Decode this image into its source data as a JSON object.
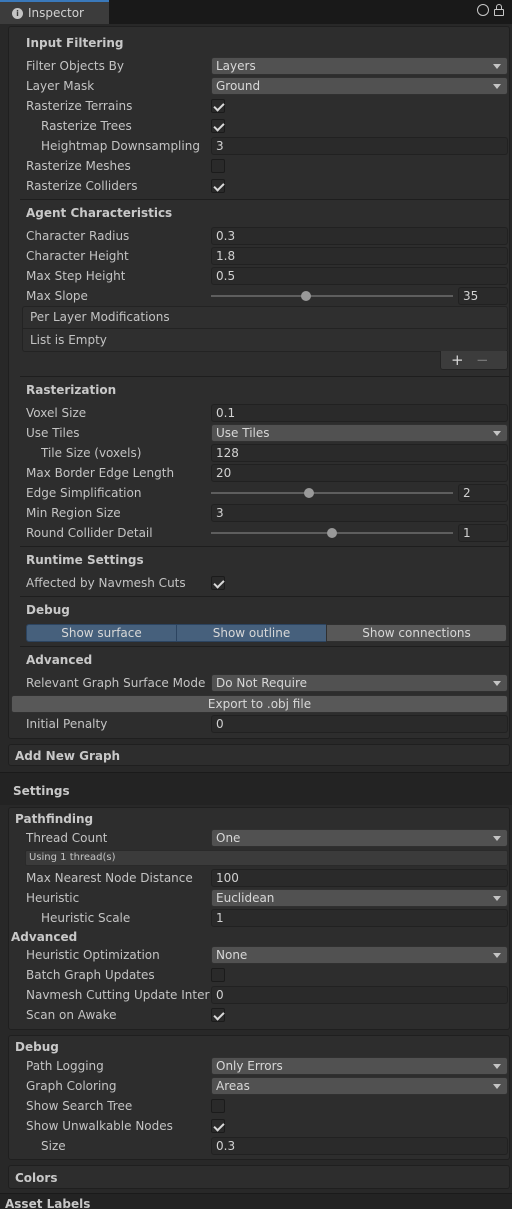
{
  "window": {
    "tab_title": "Inspector",
    "tab_icon": "info-icon"
  },
  "input_filtering": {
    "header": "Input Filtering",
    "filter_objects_by": {
      "label": "Filter Objects By",
      "value": "Layers"
    },
    "layer_mask": {
      "label": "Layer Mask",
      "value": "Ground"
    },
    "rasterize_terrains": {
      "label": "Rasterize Terrains",
      "checked": true
    },
    "rasterize_trees": {
      "label": "Rasterize Trees",
      "checked": true
    },
    "heightmap_downsampling": {
      "label": "Heightmap Downsampling",
      "value": "3"
    },
    "rasterize_meshes": {
      "label": "Rasterize Meshes",
      "checked": false
    },
    "rasterize_colliders": {
      "label": "Rasterize Colliders",
      "checked": true
    }
  },
  "agent": {
    "header": "Agent Characteristics",
    "character_radius": {
      "label": "Character Radius",
      "value": "0.3"
    },
    "character_height": {
      "label": "Character Height",
      "value": "1.8"
    },
    "max_step_height": {
      "label": "Max Step Height",
      "value": "0.5"
    },
    "max_slope": {
      "label": "Max Slope",
      "value": "35",
      "slider_fraction": 0.39
    },
    "per_layer": {
      "title": "Per Layer Modifications",
      "empty_text": "List is Empty",
      "add": "+",
      "remove": "−"
    }
  },
  "rasterization": {
    "header": "Rasterization",
    "voxel_size": {
      "label": "Voxel Size",
      "value": "0.1"
    },
    "use_tiles": {
      "label": "Use Tiles",
      "value": "Use Tiles"
    },
    "tile_size": {
      "label": "Tile Size (voxels)",
      "value": "128"
    },
    "max_border_edge": {
      "label": "Max Border Edge Length",
      "value": "20"
    },
    "edge_simplification": {
      "label": "Edge Simplification",
      "value": "2",
      "slider_fraction": 0.4
    },
    "min_region_size": {
      "label": "Min Region Size",
      "value": "3"
    },
    "round_collider_detail": {
      "label": "Round Collider Detail",
      "value": "1",
      "slider_fraction": 0.5
    }
  },
  "runtime": {
    "header": "Runtime Settings",
    "affected_by_cuts": {
      "label": "Affected by Navmesh Cuts",
      "checked": true
    }
  },
  "debug": {
    "header": "Debug",
    "show_surface": "Show surface",
    "show_outline": "Show outline",
    "show_connections": "Show connections"
  },
  "advanced": {
    "header": "Advanced",
    "surface_mode": {
      "label": "Relevant Graph Surface Mode",
      "value": "Do Not Require"
    },
    "export_button": "Export to .obj file",
    "initial_penalty": {
      "label": "Initial Penalty",
      "value": "0"
    }
  },
  "add_new_graph": "Add New Graph",
  "settings": {
    "header": "Settings",
    "pathfinding": {
      "header": "Pathfinding",
      "thread_count": {
        "label": "Thread Count",
        "value": "One"
      },
      "thread_info": "Using 1 thread(s)",
      "max_nearest": {
        "label": "Max Nearest Node Distance",
        "value": "100"
      },
      "heuristic": {
        "label": "Heuristic",
        "value": "Euclidean"
      },
      "heuristic_scale": {
        "label": "Heuristic Scale",
        "value": "1"
      }
    },
    "advanced": {
      "header": "Advanced",
      "heuristic_opt": {
        "label": "Heuristic Optimization",
        "value": "None"
      },
      "batch_updates": {
        "label": "Batch Graph Updates",
        "checked": false
      },
      "cutting_interval": {
        "label": "Navmesh Cutting Update Interval",
        "value": "0"
      },
      "scan_on_awake": {
        "label": "Scan on Awake",
        "checked": true
      }
    },
    "debug": {
      "header": "Debug",
      "path_logging": {
        "label": "Path Logging",
        "value": "Only Errors"
      },
      "graph_coloring": {
        "label": "Graph Coloring",
        "value": "Areas"
      },
      "show_search_tree": {
        "label": "Show Search Tree",
        "checked": false
      },
      "show_unwalkable": {
        "label": "Show Unwalkable Nodes",
        "checked": true
      },
      "size": {
        "label": "Size",
        "value": "0.3"
      }
    },
    "colors": "Colors"
  },
  "asset_labels": "Asset Labels"
}
